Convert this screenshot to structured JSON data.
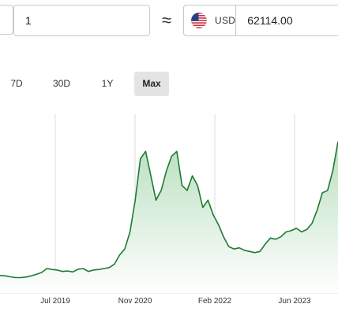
{
  "converter": {
    "amount": "1",
    "approx_symbol": "≈",
    "to_currency_code": "USD",
    "to_currency_flag": "us-flag-icon",
    "converted_value": "62114.00"
  },
  "range_tabs": [
    {
      "label": "7D",
      "active": false
    },
    {
      "label": "30D",
      "active": false
    },
    {
      "label": "1Y",
      "active": false
    },
    {
      "label": "Max",
      "active": true
    }
  ],
  "colors": {
    "line": "#1e7a32",
    "fill_top": "#b9dfbf",
    "fill_bottom": "#ffffff",
    "grid": "#dcdcdc",
    "active_tab": "#e4e4e4"
  },
  "chart_data": {
    "type": "area",
    "title": "",
    "xlabel": "",
    "ylabel": "",
    "grid": "vertical",
    "x_ticks": [
      "Jul 2019",
      "Nov 2020",
      "Feb 2022",
      "Jun 2023"
    ],
    "x": [
      "2018-10",
      "2018-11",
      "2018-12",
      "2019-01",
      "2019-02",
      "2019-03",
      "2019-04",
      "2019-05",
      "2019-06",
      "2019-07",
      "2019-08",
      "2019-09",
      "2019-10",
      "2019-11",
      "2019-12",
      "2020-01",
      "2020-02",
      "2020-03",
      "2020-04",
      "2020-05",
      "2020-06",
      "2020-07",
      "2020-08",
      "2020-09",
      "2020-10",
      "2020-11",
      "2020-12",
      "2021-01",
      "2021-02",
      "2021-03",
      "2021-04",
      "2021-05",
      "2021-06",
      "2021-07",
      "2021-08",
      "2021-09",
      "2021-10",
      "2021-11",
      "2021-12",
      "2022-01",
      "2022-02",
      "2022-03",
      "2022-04",
      "2022-05",
      "2022-06",
      "2022-07",
      "2022-08",
      "2022-09",
      "2022-10",
      "2022-11",
      "2022-12",
      "2023-01",
      "2023-02",
      "2023-03",
      "2023-04",
      "2023-05",
      "2023-06",
      "2023-07",
      "2023-08",
      "2023-09",
      "2023-10",
      "2023-11",
      "2023-12",
      "2024-01",
      "2024-02",
      "2024-03"
    ],
    "y": [
      7.2,
      7.0,
      6.6,
      6.3,
      6.3,
      6.5,
      7.0,
      7.6,
      8.4,
      10.0,
      9.6,
      9.4,
      8.8,
      9.0,
      8.6,
      9.7,
      10.0,
      8.8,
      9.4,
      9.6,
      10.0,
      10.4,
      11.8,
      15.5,
      18.0,
      25.0,
      38.0,
      55.0,
      58.0,
      48.0,
      38.0,
      42.0,
      50.0,
      56.0,
      58.0,
      44.0,
      42.0,
      48.0,
      44.0,
      35.0,
      38.0,
      32.0,
      28.0,
      23.0,
      19.0,
      18.0,
      18.5,
      17.5,
      17.0,
      16.5,
      17.0,
      20.0,
      22.5,
      22.0,
      23.0,
      25.0,
      25.5,
      26.5,
      25.0,
      26.0,
      28.5,
      34.0,
      41.0,
      42.0,
      50.0,
      62.0
    ],
    "ylim": [
      0,
      70
    ]
  }
}
